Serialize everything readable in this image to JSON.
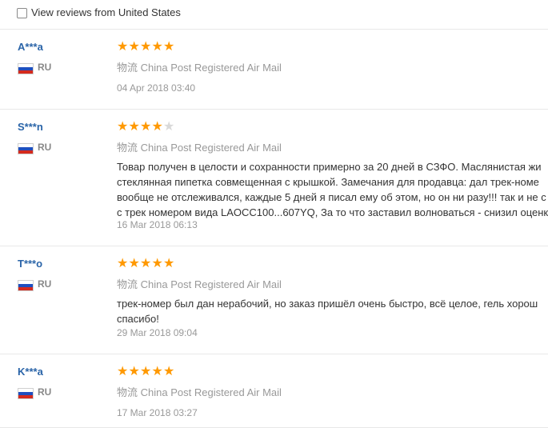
{
  "filter": {
    "label": "View reviews from United States",
    "checked": false
  },
  "colors": {
    "username": "#2a64a8",
    "star_filled": "#ff9900",
    "star_empty": "#d9d9d9",
    "muted": "#999999"
  },
  "reviews": [
    {
      "user": "A***a",
      "country": "RU",
      "rating": 5,
      "shipping_prefix": "物流",
      "shipping_method": "China Post Registered Air Mail",
      "text": [],
      "date": "04 Apr 2018 03:40"
    },
    {
      "user": "S***n",
      "country": "RU",
      "rating": 4,
      "shipping_prefix": "物流",
      "shipping_method": "China Post Registered Air Mail",
      "text": [
        "Товар получен в целости и сохранности примерно за 20 дней в СЗФО. Маслянистая жи",
        "стеклянная пипетка совмещенная с крышкой. Замечания для продавца: дал трек-номе",
        "вообще не отслеживался, каждые 5 дней я писал ему об этом, но он ни разу!!! так и не с",
        "с трек номером вида LAOCC100...607YQ, За то что заставил волноваться - снизил оценк"
      ],
      "date": "16 Mar 2018 06:13"
    },
    {
      "user": "T***o",
      "country": "RU",
      "rating": 5,
      "shipping_prefix": "物流",
      "shipping_method": "China Post Registered Air Mail",
      "text": [
        "трек-номер был дан нерабочий, но заказ пришёл очень быстро, всё целое, гель хорош",
        "спасибо!"
      ],
      "date": "29 Mar 2018 09:04"
    },
    {
      "user": "K***a",
      "country": "RU",
      "rating": 5,
      "shipping_prefix": "物流",
      "shipping_method": "China Post Registered Air Mail",
      "text": [],
      "date": "17 Mar 2018 03:27"
    }
  ]
}
